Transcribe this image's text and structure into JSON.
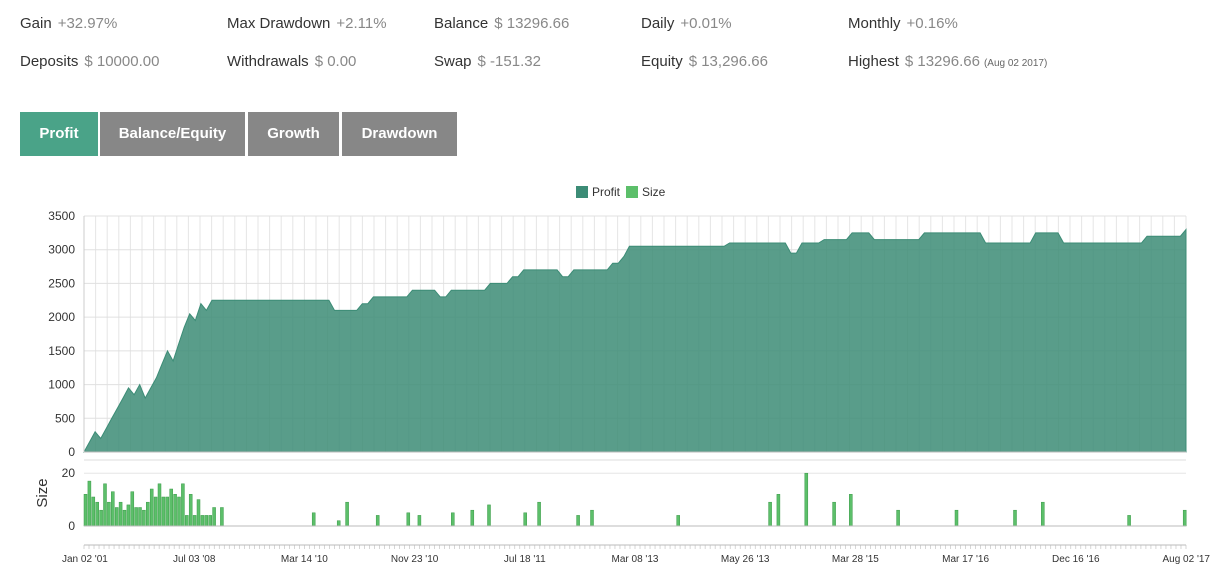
{
  "stats": {
    "gain": {
      "label": "Gain",
      "value": "+32.97%"
    },
    "max_drawdown": {
      "label": "Max Drawdown",
      "value": "+2.11%"
    },
    "balance": {
      "label": "Balance",
      "value": "$ 13296.66"
    },
    "daily": {
      "label": "Daily",
      "value": "+0.01%"
    },
    "monthly": {
      "label": "Monthly",
      "value": "+0.16%"
    },
    "deposits": {
      "label": "Deposits",
      "value": "$ 10000.00"
    },
    "withdrawals": {
      "label": "Withdrawals",
      "value": "$ 0.00"
    },
    "swap": {
      "label": "Swap",
      "value": "$ -151.32"
    },
    "equity": {
      "label": "Equity",
      "value": "$ 13,296.66"
    },
    "highest": {
      "label": "Highest",
      "value": "$ 13296.66",
      "date": "(Aug 02 2017)"
    }
  },
  "tabs": [
    {
      "label": "Profit",
      "active": true
    },
    {
      "label": "Balance/Equity",
      "active": false
    },
    {
      "label": "Growth",
      "active": false
    },
    {
      "label": "Drawdown",
      "active": false
    }
  ],
  "colors": {
    "profit": "#3c8c76",
    "size": "#5cbf6a",
    "tab_active": "#4aa388",
    "tab_inactive": "#878787"
  },
  "chart_data": {
    "type": "area",
    "legend": [
      "Profit",
      "Size"
    ],
    "y_ticks": [
      "3500",
      "3000",
      "2500",
      "2000",
      "1500",
      "1000",
      "500",
      "0"
    ],
    "ylim": [
      0,
      3500
    ],
    "size_ylabel": "Size",
    "size_ticks": [
      "20",
      "0"
    ],
    "size_ylim": [
      0,
      25
    ],
    "x_ticks": [
      "Jan 02 '01",
      "Jul 03 '08",
      "Mar 14 '10",
      "Nov 23 '10",
      "Jul 18 '11",
      "Mar 08 '13",
      "May 26 '13",
      "Mar 28 '15",
      "Mar 17 '16",
      "Dec 16 '16",
      "Aug 02 '17"
    ],
    "profit_series": [
      [
        0,
        0
      ],
      [
        1,
        150
      ],
      [
        2,
        300
      ],
      [
        3,
        200
      ],
      [
        4,
        350
      ],
      [
        5,
        500
      ],
      [
        6,
        650
      ],
      [
        7,
        800
      ],
      [
        8,
        950
      ],
      [
        9,
        850
      ],
      [
        10,
        1000
      ],
      [
        11,
        800
      ],
      [
        12,
        950
      ],
      [
        13,
        1100
      ],
      [
        14,
        1300
      ],
      [
        15,
        1500
      ],
      [
        16,
        1350
      ],
      [
        17,
        1600
      ],
      [
        18,
        1850
      ],
      [
        19,
        2050
      ],
      [
        20,
        1950
      ],
      [
        21,
        2200
      ],
      [
        22,
        2100
      ],
      [
        23,
        2250
      ],
      [
        30,
        2250
      ],
      [
        40,
        2250
      ],
      [
        44,
        2250
      ],
      [
        45,
        2100
      ],
      [
        49,
        2100
      ],
      [
        50,
        2200
      ],
      [
        51,
        2200
      ],
      [
        52,
        2300
      ],
      [
        58,
        2300
      ],
      [
        59,
        2400
      ],
      [
        63,
        2400
      ],
      [
        64,
        2300
      ],
      [
        65,
        2300
      ],
      [
        66,
        2400
      ],
      [
        72,
        2400
      ],
      [
        73,
        2500
      ],
      [
        76,
        2500
      ],
      [
        77,
        2600
      ],
      [
        78,
        2600
      ],
      [
        79,
        2700
      ],
      [
        85,
        2700
      ],
      [
        86,
        2600
      ],
      [
        87,
        2600
      ],
      [
        88,
        2700
      ],
      [
        94,
        2700
      ],
      [
        95,
        2800
      ],
      [
        96,
        2800
      ],
      [
        97,
        2900
      ],
      [
        98,
        3050
      ],
      [
        107,
        3050
      ],
      [
        115,
        3050
      ],
      [
        116,
        3100
      ],
      [
        126,
        3100
      ],
      [
        127,
        2950
      ],
      [
        128,
        2950
      ],
      [
        129,
        3100
      ],
      [
        132,
        3100
      ],
      [
        133,
        3150
      ],
      [
        137,
        3150
      ],
      [
        138,
        3250
      ],
      [
        141,
        3250
      ],
      [
        142,
        3150
      ],
      [
        150,
        3150
      ],
      [
        151,
        3250
      ],
      [
        161,
        3250
      ],
      [
        162,
        3100
      ],
      [
        170,
        3100
      ],
      [
        171,
        3250
      ],
      [
        175,
        3250
      ],
      [
        176,
        3100
      ],
      [
        190,
        3100
      ],
      [
        191,
        3200
      ],
      [
        197,
        3200
      ],
      [
        198,
        3300
      ]
    ],
    "profit_x_max": 198,
    "size_bars": [
      [
        0,
        12
      ],
      [
        0.7,
        17
      ],
      [
        1.4,
        11
      ],
      [
        2.1,
        9
      ],
      [
        2.8,
        6
      ],
      [
        3.5,
        16
      ],
      [
        4.2,
        9
      ],
      [
        4.9,
        13
      ],
      [
        5.6,
        7
      ],
      [
        6.3,
        9
      ],
      [
        7,
        6
      ],
      [
        7.7,
        8
      ],
      [
        8.4,
        13
      ],
      [
        9.1,
        7
      ],
      [
        9.8,
        7
      ],
      [
        10.5,
        6
      ],
      [
        11.2,
        9
      ],
      [
        11.9,
        14
      ],
      [
        12.6,
        11
      ],
      [
        13.3,
        16
      ],
      [
        14,
        11
      ],
      [
        14.7,
        11
      ],
      [
        15.4,
        14
      ],
      [
        16.1,
        12
      ],
      [
        16.8,
        11
      ],
      [
        17.5,
        16
      ],
      [
        18.2,
        4
      ],
      [
        18.9,
        12
      ],
      [
        19.6,
        4
      ],
      [
        20.3,
        10
      ],
      [
        21,
        4
      ],
      [
        21.7,
        4
      ],
      [
        22.4,
        4
      ],
      [
        23.1,
        7
      ],
      [
        24.5,
        7
      ],
      [
        41,
        5
      ],
      [
        45.5,
        2
      ],
      [
        47,
        9
      ],
      [
        52.5,
        4
      ],
      [
        58,
        5
      ],
      [
        60,
        4
      ],
      [
        66,
        5
      ],
      [
        69.5,
        6
      ],
      [
        72.5,
        8
      ],
      [
        79,
        5
      ],
      [
        81.5,
        9
      ],
      [
        88.5,
        4
      ],
      [
        91,
        6
      ],
      [
        106.5,
        4
      ],
      [
        123,
        9
      ],
      [
        124.5,
        12
      ],
      [
        129.5,
        20
      ],
      [
        134.5,
        9
      ],
      [
        137.5,
        12
      ],
      [
        146,
        6
      ],
      [
        156.5,
        6
      ],
      [
        167,
        6
      ],
      [
        172,
        9
      ],
      [
        187.5,
        4
      ],
      [
        197.5,
        6
      ]
    ]
  }
}
